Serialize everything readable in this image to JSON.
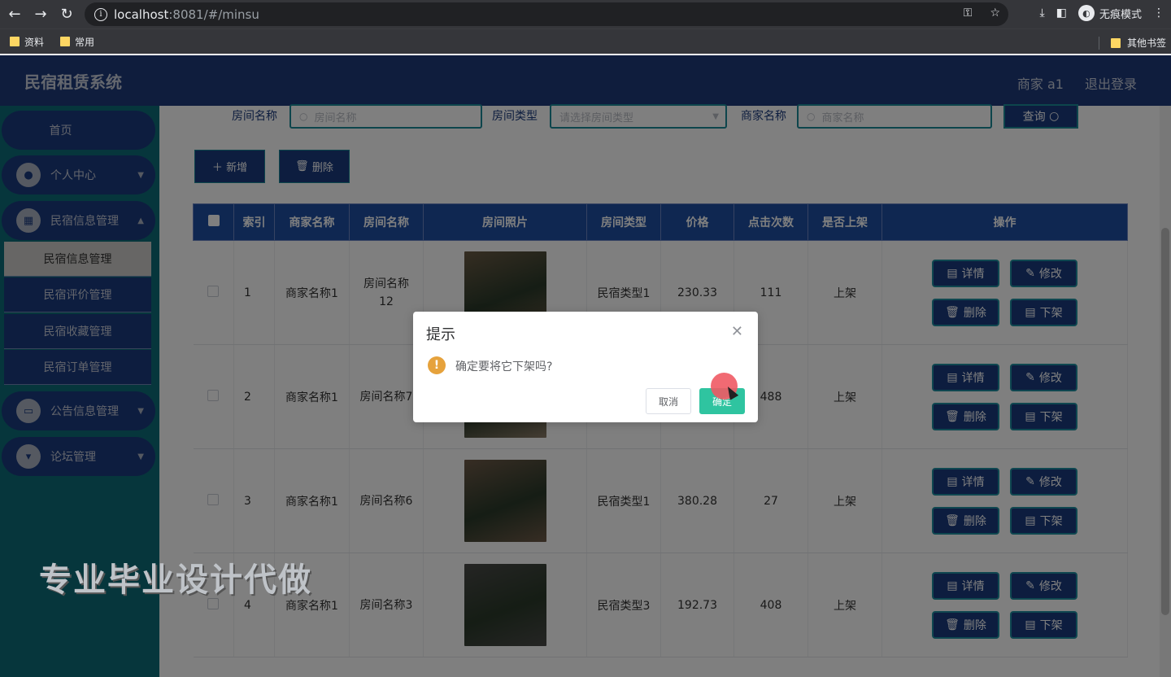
{
  "browser": {
    "url_host": "localhost",
    "url_path": ":8081/#/minsu",
    "incognito_label": "无痕模式",
    "bookmarks": [
      "资料",
      "常用"
    ],
    "other_bookmarks": "其他书签"
  },
  "header": {
    "title": "民宿租赁系统",
    "user": "商家 a1",
    "logout": "退出登录"
  },
  "sidebar": {
    "home": "首页",
    "personal": "个人中心",
    "info_mgmt": "民宿信息管理",
    "sub_items": [
      "民宿信息管理",
      "民宿评价管理",
      "民宿收藏管理",
      "民宿订单管理"
    ],
    "notice_mgmt": "公告信息管理",
    "forum_mgmt": "论坛管理"
  },
  "search": {
    "room_name_label": "房间名称",
    "room_name_placeholder": "房间名称",
    "room_type_label": "房间类型",
    "room_type_placeholder": "请选择房间类型",
    "merchant_label": "商家名称",
    "merchant_placeholder": "商家名称",
    "query_btn": "查询"
  },
  "actions": {
    "add": "新增",
    "delete": "删除"
  },
  "table": {
    "headers": [
      "索引",
      "商家名称",
      "房间名称",
      "房间照片",
      "房间类型",
      "价格",
      "点击次数",
      "是否上架",
      "操作"
    ],
    "ops": {
      "detail": "详情",
      "edit": "修改",
      "delete": "删除",
      "off": "下架"
    },
    "rows": [
      {
        "index": "1",
        "merchant": "商家名称1",
        "room": "房间名称12",
        "type": "民宿类型1",
        "price": "230.33",
        "clicks": "111",
        "status": "上架",
        "photo": "#6b5b45"
      },
      {
        "index": "2",
        "merchant": "商家名称1",
        "room": "房间名称7",
        "type": "",
        "price": "",
        "clicks": "488",
        "status": "上架",
        "photo": "#8a7a66"
      },
      {
        "index": "3",
        "merchant": "商家名称1",
        "room": "房间名称6",
        "type": "民宿类型1",
        "price": "380.28",
        "clicks": "27",
        "status": "上架",
        "photo": "#6e5a48"
      },
      {
        "index": "4",
        "merchant": "商家名称1",
        "room": "房间名称3",
        "type": "民宿类型3",
        "price": "192.73",
        "clicks": "408",
        "status": "上架",
        "photo": "#4a4a48"
      }
    ]
  },
  "dialog": {
    "title": "提示",
    "message": "确定要将它下架吗?",
    "cancel": "取消",
    "confirm": "确定"
  },
  "watermark": "专业毕业设计代做"
}
